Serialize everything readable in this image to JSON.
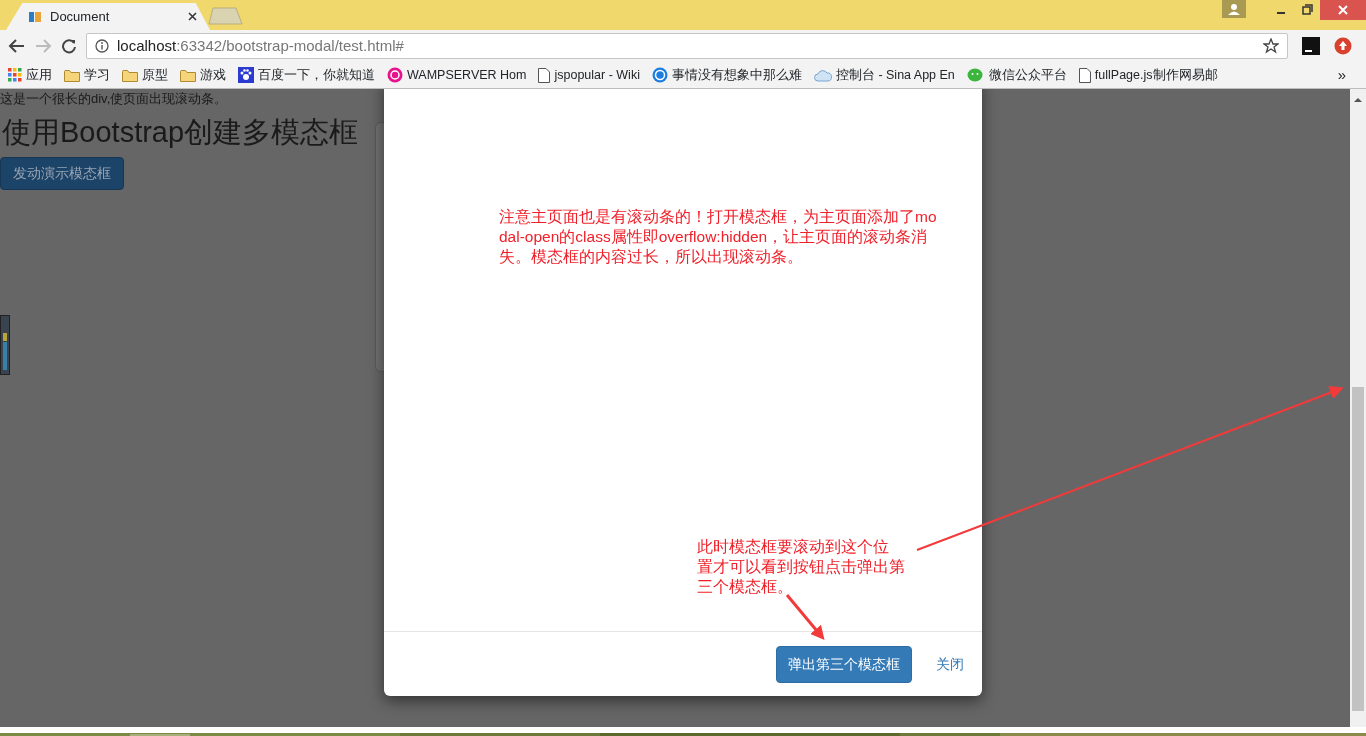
{
  "tab": {
    "title": "Document"
  },
  "address_bar": {
    "host": "localhost",
    "path": ":63342/bootstrap-modal/test.html#"
  },
  "bookmarks": [
    {
      "label": "应用",
      "kind": "apps"
    },
    {
      "label": "学习",
      "kind": "folder"
    },
    {
      "label": "原型",
      "kind": "folder"
    },
    {
      "label": "游戏",
      "kind": "folder"
    },
    {
      "label": "百度一下，你就知道",
      "kind": "paw"
    },
    {
      "label": "WAMPSERVER Hom",
      "kind": "wamp"
    },
    {
      "label": "jspopular - Wiki",
      "kind": "page"
    },
    {
      "label": "事情没有想象中那么难",
      "kind": "circle"
    },
    {
      "label": "控制台 - Sina App En",
      "kind": "cloud"
    },
    {
      "label": "微信公众平台",
      "kind": "chat"
    },
    {
      "label": "fullPage.js制作网易邮",
      "kind": "page"
    }
  ],
  "more_bookmarks": "»",
  "page": {
    "intro": "这是一个很长的div,使页面出现滚动条。",
    "heading": "使用Bootstrap创建多模态框",
    "launch_button": "发动演示模态框"
  },
  "modal": {
    "note": "注意主页面也是有滚动条的！打开模态框，为主页面添加了modal-open的class属性即overflow:hidden，让主页面的滚动条消失。模态框的内容过长，所以出现滚动条。",
    "hint": "此时模态框要滚动到这个位置才可以看到按钮点击弹出第三个模态框。",
    "primary_button": "弹出第三个模态框",
    "close_link": "关闭"
  }
}
